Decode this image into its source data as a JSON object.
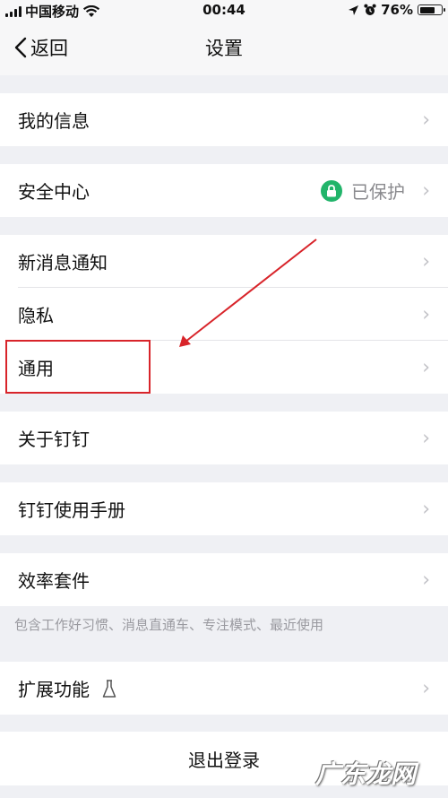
{
  "status_bar": {
    "carrier": "中国移动",
    "time": "00:44",
    "battery": "76%",
    "battery_level": 0.76
  },
  "nav": {
    "back_label": "返回",
    "title": "设置"
  },
  "rows": {
    "my_info": "我的信息",
    "security_center": "安全中心",
    "security_status": "已保护",
    "new_message_notice": "新消息通知",
    "privacy": "隐私",
    "general": "通用",
    "about": "关于钉钉",
    "manual": "钉钉使用手册",
    "efficiency_suite": "效率套件",
    "efficiency_hint": "包含工作好习惯、消息直通车、专注模式、最近使用",
    "extensions": "扩展功能",
    "logout": "退出登录"
  },
  "watermark": "广东龙网",
  "colors": {
    "background": "#eff0f4",
    "accent_green": "#21b46a",
    "annotation_red": "#d8242a"
  },
  "icons": [
    "signal-icon",
    "wifi-icon",
    "location-icon",
    "alarm-icon",
    "battery-icon",
    "back-chevron-icon",
    "lock-icon",
    "flask-icon",
    "chevron-right-icon"
  ]
}
